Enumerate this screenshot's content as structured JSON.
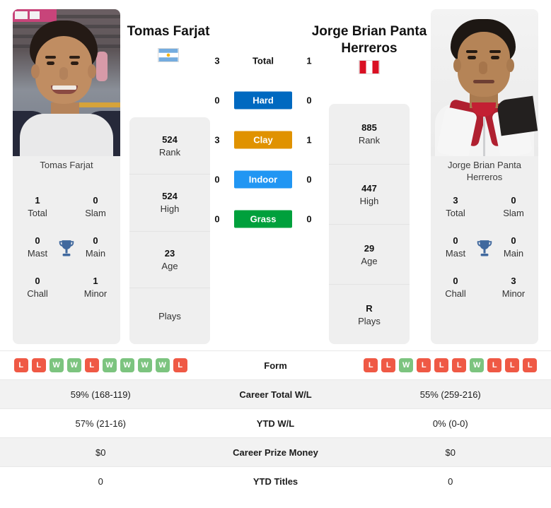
{
  "players": {
    "left": {
      "name": "Tomas Farjat",
      "card_name": "Tomas Farjat",
      "flag": "argentina-flag",
      "stats": [
        {
          "value": "524",
          "label": "Rank"
        },
        {
          "value": "524",
          "label": "High"
        },
        {
          "value": "23",
          "label": "Age"
        },
        {
          "value": "",
          "label": "Plays"
        }
      ],
      "titles": [
        {
          "value": "1",
          "label": "Total"
        },
        {
          "value": "0",
          "label": "Slam"
        },
        {
          "value": "0",
          "label": "Mast"
        },
        {
          "value": "0",
          "label": "Main"
        },
        {
          "value": "0",
          "label": "Chall"
        },
        {
          "value": "1",
          "label": "Minor"
        }
      ],
      "form": [
        "L",
        "L",
        "W",
        "W",
        "L",
        "W",
        "W",
        "W",
        "W",
        "L"
      ],
      "career_total_wl": "59% (168-119)",
      "ytd_wl": "57% (21-16)",
      "career_prize_money": "$0",
      "ytd_titles": "0"
    },
    "right": {
      "name": "Jorge Brian Panta Herreros",
      "card_name": "Jorge Brian Panta Herreros",
      "flag": "peru-flag",
      "stats": [
        {
          "value": "885",
          "label": "Rank"
        },
        {
          "value": "447",
          "label": "High"
        },
        {
          "value": "29",
          "label": "Age"
        },
        {
          "value": "R",
          "label": "Plays"
        }
      ],
      "titles": [
        {
          "value": "3",
          "label": "Total"
        },
        {
          "value": "0",
          "label": "Slam"
        },
        {
          "value": "0",
          "label": "Mast"
        },
        {
          "value": "0",
          "label": "Main"
        },
        {
          "value": "0",
          "label": "Chall"
        },
        {
          "value": "3",
          "label": "Minor"
        }
      ],
      "form": [
        "L",
        "L",
        "W",
        "L",
        "L",
        "L",
        "W",
        "L",
        "L",
        "L"
      ],
      "career_total_wl": "55% (259-216)",
      "ytd_wl": "0% (0-0)",
      "career_prize_money": "$0",
      "ytd_titles": "0"
    }
  },
  "surfaces": [
    {
      "label": "Total",
      "left": "3",
      "right": "1",
      "color": "",
      "plain": true
    },
    {
      "label": "Hard",
      "left": "0",
      "right": "0",
      "color": "#0069c0",
      "plain": false
    },
    {
      "label": "Clay",
      "left": "3",
      "right": "1",
      "color": "#e09200",
      "plain": false
    },
    {
      "label": "Indoor",
      "left": "0",
      "right": "0",
      "color": "#2196f3",
      "plain": false
    },
    {
      "label": "Grass",
      "left": "0",
      "right": "0",
      "color": "#00a03c",
      "plain": false
    }
  ],
  "table_rows": [
    {
      "label": "Form",
      "type": "form",
      "shaded": false
    },
    {
      "label": "Career Total W/L",
      "type": "text",
      "shaded": true,
      "key": "career_total_wl"
    },
    {
      "label": "YTD W/L",
      "type": "text",
      "shaded": false,
      "key": "ytd_wl"
    },
    {
      "label": "Career Prize Money",
      "type": "text",
      "shaded": true,
      "key": "career_prize_money"
    },
    {
      "label": "YTD Titles",
      "type": "text",
      "shaded": false,
      "key": "ytd_titles"
    }
  ],
  "colors": {
    "win_badge": "#7cc47f",
    "loss_badge": "#ef5945",
    "trophy": "#41699e",
    "panel": "#efefef"
  }
}
